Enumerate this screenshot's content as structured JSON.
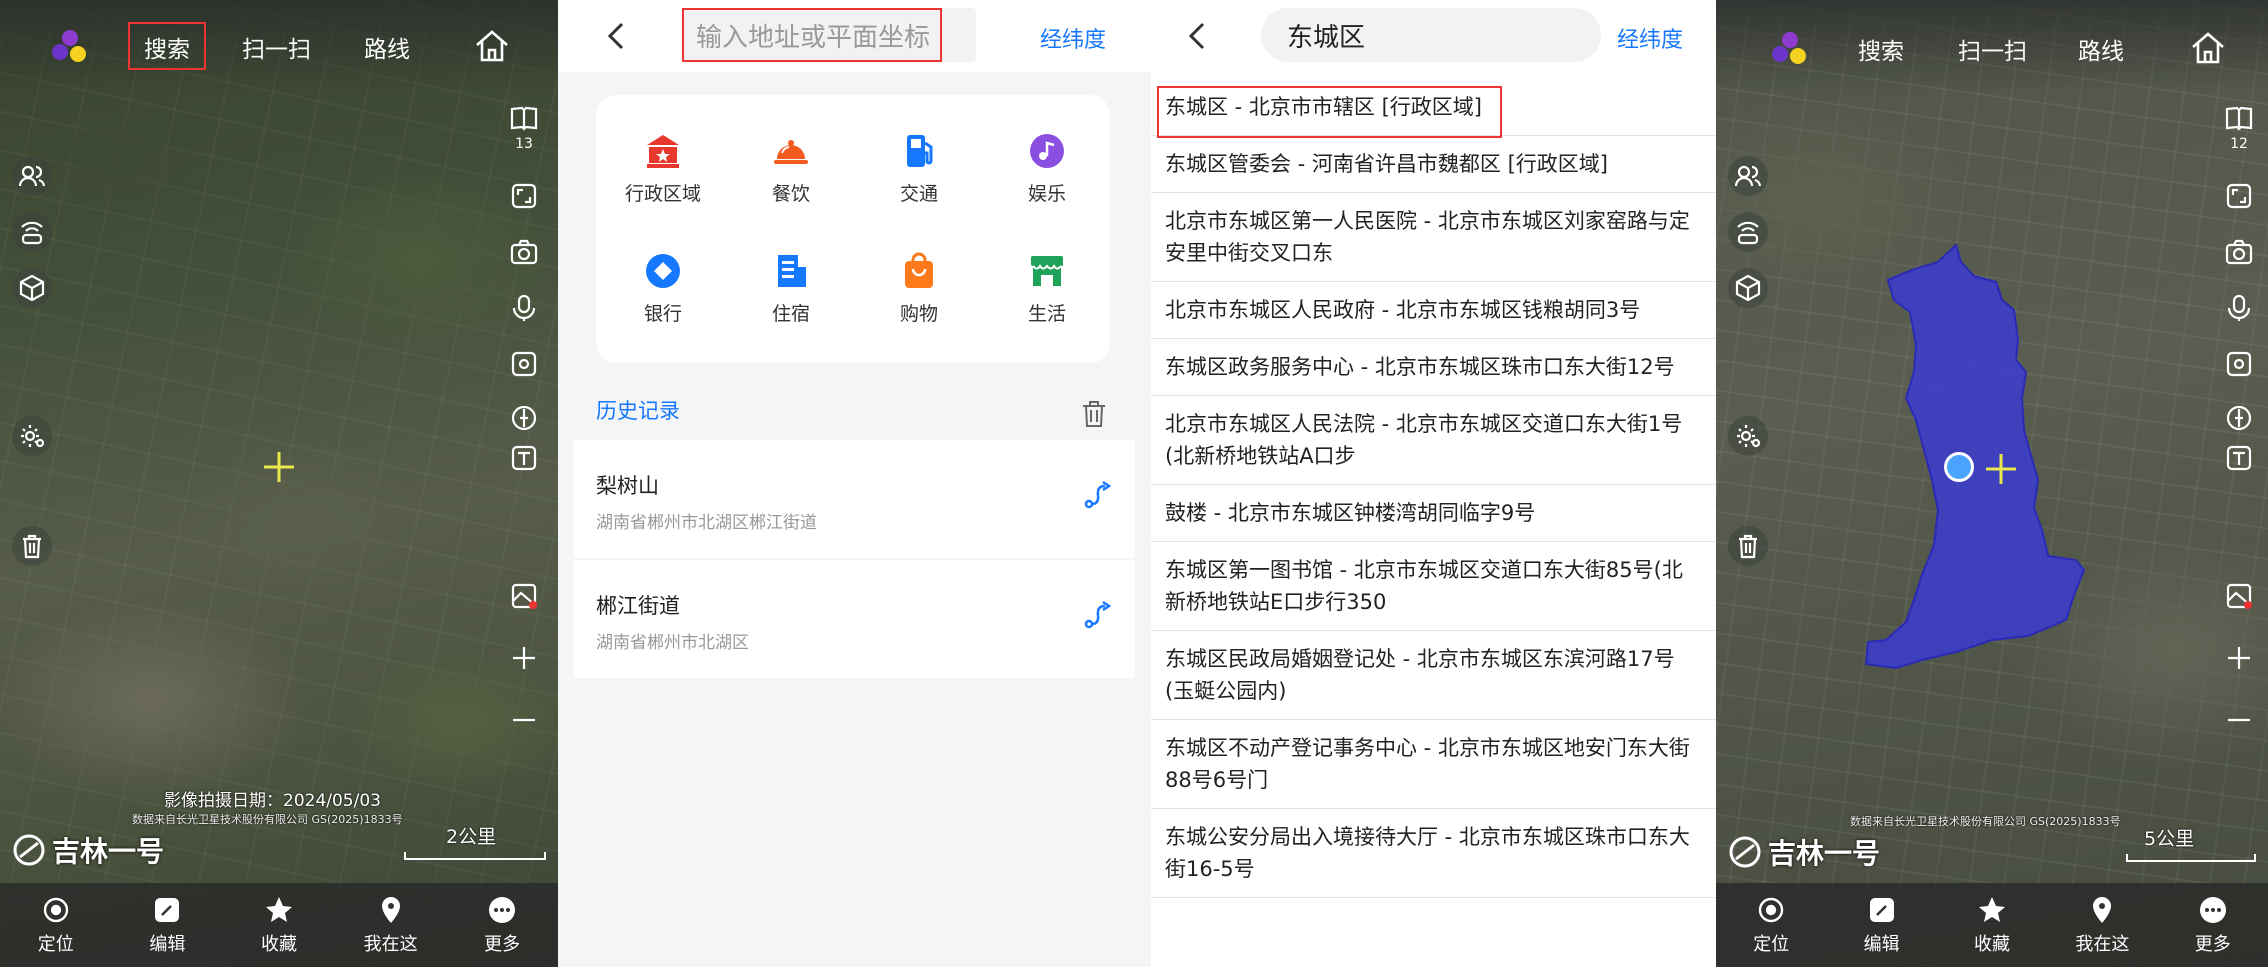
{
  "panel1": {
    "nav": {
      "search": "搜索",
      "scan": "扫一扫",
      "route": "路线"
    },
    "zoom_level": "13",
    "image_date": "影像拍摄日期：2024/05/03",
    "credit": "数据来自长光卫星技术股份有限公司 GS(2025)1833号",
    "brand": "吉林一号",
    "scale": "2公里",
    "bottom": {
      "locate": "定位",
      "edit": "编辑",
      "favorite": "收藏",
      "here": "我在这",
      "more": "更多"
    }
  },
  "panel2": {
    "search_placeholder": "输入地址或平面坐标",
    "lnglat_button": "经纬度",
    "categories": [
      {
        "label": "行政区域",
        "icon": "government-icon",
        "color": "#e8372c"
      },
      {
        "label": "餐饮",
        "icon": "dining-icon",
        "color": "#f25a1e"
      },
      {
        "label": "交通",
        "icon": "fuel-icon",
        "color": "#1677ff"
      },
      {
        "label": "娱乐",
        "icon": "music-icon",
        "color": "#8a4fe0"
      },
      {
        "label": "银行",
        "icon": "bank-icon",
        "color": "#1677ff"
      },
      {
        "label": "住宿",
        "icon": "hotel-icon",
        "color": "#1677ff"
      },
      {
        "label": "购物",
        "icon": "shopping-icon",
        "color": "#ff7a1a"
      },
      {
        "label": "生活",
        "icon": "store-icon",
        "color": "#1fa35b"
      }
    ],
    "history_title": "历史记录",
    "history": [
      {
        "name": "梨树山",
        "address": "湖南省郴州市北湖区郴江街道"
      },
      {
        "name": "郴江街道",
        "address": "湖南省郴州市北湖区"
      }
    ]
  },
  "panel3": {
    "search_value": "东城区",
    "lnglat_button": "经纬度",
    "results": [
      "东城区 - 北京市市辖区 [行政区域]",
      "东城区管委会 - 河南省许昌市魏都区 [行政区域]",
      "北京市东城区第一人民医院 - 北京市东城区刘家窑路与定安里中街交叉口东",
      "北京市东城区人民政府 - 北京市东城区钱粮胡同3号",
      "东城区政务服务中心 - 北京市东城区珠市口东大街12号",
      "北京市东城区人民法院 - 北京市东城区交道口东大街1号(北新桥地铁站A口步",
      "鼓楼 - 北京市东城区钟楼湾胡同临字9号",
      "东城区第一图书馆 - 北京市东城区交道口东大街85号(北新桥地铁站E口步行350",
      "东城区民政局婚姻登记处 - 北京市东城区东滨河路17号(玉蜓公园内)",
      "东城区不动产登记事务中心 - 北京市东城区地安门东大街88号6号门",
      "东城公安分局出入境接待大厅 - 北京市东城区珠市口东大街16-5号"
    ]
  },
  "panel4": {
    "nav": {
      "search": "搜索",
      "scan": "扫一扫",
      "route": "路线"
    },
    "zoom_level": "12",
    "credit": "数据来自长光卫星技术股份有限公司 GS(2025)1833号",
    "brand": "吉林一号",
    "scale": "5公里",
    "boundary_color": "#3b3bd6",
    "bottom": {
      "locate": "定位",
      "edit": "编辑",
      "favorite": "收藏",
      "here": "我在这",
      "more": "更多"
    }
  }
}
